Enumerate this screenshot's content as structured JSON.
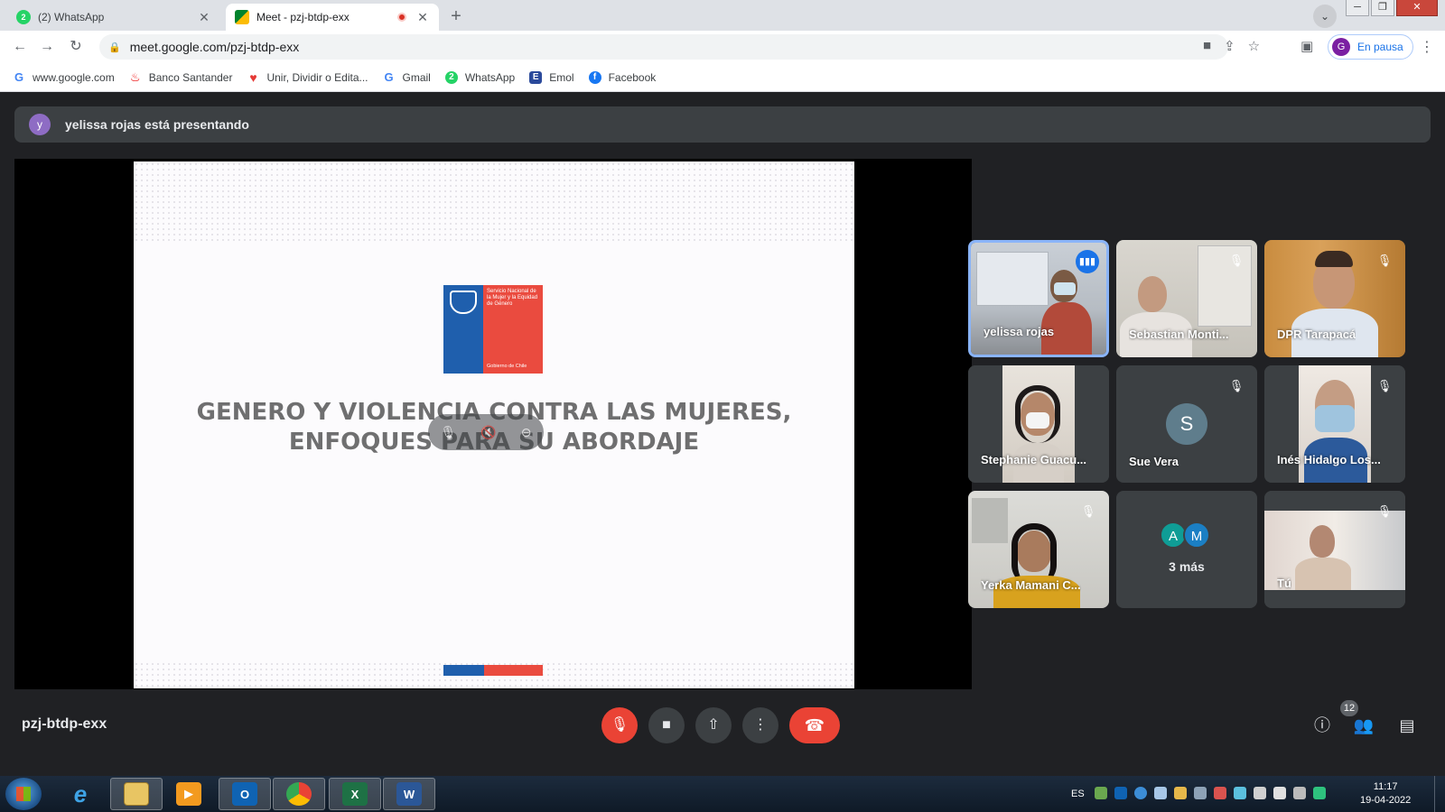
{
  "browser": {
    "tabs": [
      {
        "title": "(2) WhatsApp",
        "favicon": "whatsapp-icon",
        "badge": "2"
      },
      {
        "title": "Meet - pzj-btdp-exx",
        "favicon": "meet-icon",
        "recording": true
      }
    ],
    "url": "meet.google.com/pzj-btdp-exx",
    "profile_initial": "G",
    "profile_status": "En pausa",
    "bookmarks": [
      {
        "label": "www.google.com",
        "icon": "google-icon",
        "color": "#4285f4"
      },
      {
        "label": "Banco Santander",
        "icon": "santander-icon",
        "color": "#ec0000"
      },
      {
        "label": "Unir, Dividir o Edita...",
        "icon": "heart-icon",
        "color": "#e53935"
      },
      {
        "label": "Gmail",
        "icon": "google-icon",
        "color": "#4285f4"
      },
      {
        "label": "WhatsApp",
        "icon": "whatsapp-icon",
        "color": "#25d366"
      },
      {
        "label": "Emol",
        "icon": "emol-icon",
        "color": "#2b4a9b"
      },
      {
        "label": "Facebook",
        "icon": "facebook-icon",
        "color": "#1877f2"
      }
    ]
  },
  "meet": {
    "presenter_initial": "y",
    "presenter_banner": "yelissa rojas está presentando",
    "slide": {
      "logo_text": "Servicio Nacional de la Mujer y la Equidad de Género",
      "logo_footer": "Gobierno de Chile",
      "title_line1": "GENERO Y VIOLENCIA CONTRA LAS MUJERES,",
      "title_line2": "ENFOQUES PARA SU ABORDAJE"
    },
    "participants": [
      {
        "name": "yelissa rojas",
        "speaking": true
      },
      {
        "name": "Sebastian Monti..."
      },
      {
        "name": "DPR Tarapacá"
      },
      {
        "name": "Stephanie Guacu..."
      },
      {
        "name": "Sue Vera",
        "initial": "S"
      },
      {
        "name": "Inés Hidalgo Los..."
      },
      {
        "name": "Yerka Mamani C..."
      },
      {
        "name": "3 más",
        "avatars": [
          "A",
          "M"
        ]
      },
      {
        "name": "Tú"
      }
    ],
    "meeting_code": "pzj-btdp-exx",
    "participant_count": "12"
  },
  "taskbar": {
    "language": "ES",
    "time": "11:17",
    "date": "19-04-2022",
    "apps": [
      {
        "name": "internet-explorer",
        "label": "e"
      },
      {
        "name": "file-explorer",
        "label": ""
      },
      {
        "name": "media-player",
        "label": ""
      },
      {
        "name": "outlook",
        "label": "O"
      },
      {
        "name": "chrome",
        "label": ""
      },
      {
        "name": "excel",
        "label": "X"
      },
      {
        "name": "word",
        "label": "W"
      }
    ]
  }
}
